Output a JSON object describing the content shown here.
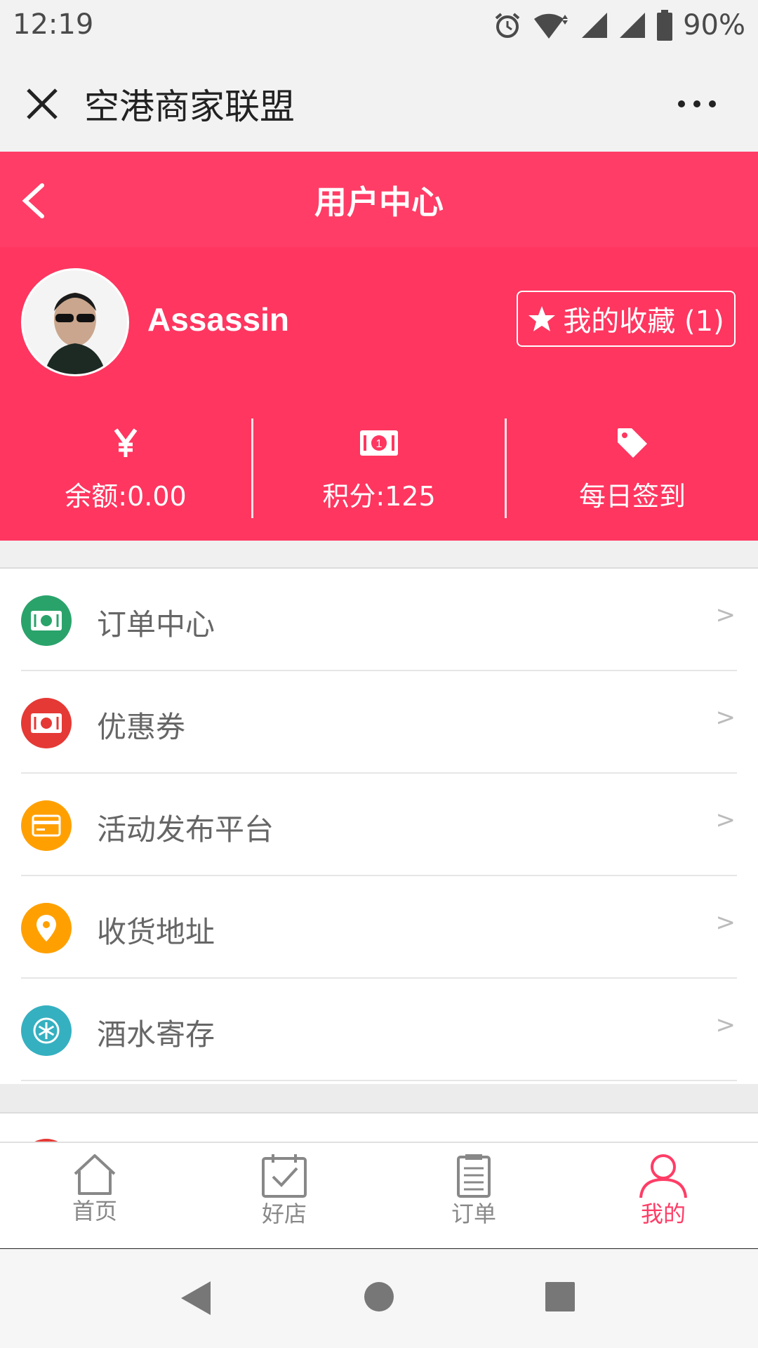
{
  "status_bar": {
    "time": "12:19",
    "battery": "90%",
    "icons": [
      "alarm-icon",
      "wifi-icon",
      "signal-icon",
      "signal-icon",
      "battery-icon"
    ]
  },
  "mini_program": {
    "title": "空港商家联盟"
  },
  "header": {
    "title": "用户中心"
  },
  "profile": {
    "username": "Assassin",
    "favorites_label": "我的收藏 (1)"
  },
  "stats": [
    {
      "icon": "yen-icon",
      "label": "余额:0.00"
    },
    {
      "icon": "cash-icon",
      "label": "积分:125"
    },
    {
      "icon": "tag-icon",
      "label": "每日签到"
    }
  ],
  "menu": [
    {
      "label": "订单中心",
      "icon": "cash-icon",
      "color": "#2aa36b",
      "arrow": ">"
    },
    {
      "label": "优惠券",
      "icon": "cash-icon",
      "color": "#e53935",
      "arrow": ">"
    },
    {
      "label": "活动发布平台",
      "icon": "card-icon",
      "color": "#ffa000",
      "arrow": ">"
    },
    {
      "label": "收货地址",
      "icon": "location-pin-icon",
      "color": "#ffa000",
      "arrow": ">"
    },
    {
      "label": "酒水寄存",
      "icon": "snowflake-icon",
      "color": "#35b0c0",
      "arrow": ">"
    }
  ],
  "tabbar": [
    {
      "label": "首页",
      "icon": "home-icon",
      "active": false
    },
    {
      "label": "好店",
      "icon": "calendar-check-icon",
      "active": false
    },
    {
      "label": "订单",
      "icon": "clipboard-icon",
      "active": false
    },
    {
      "label": "我的",
      "icon": "user-icon",
      "active": true
    }
  ],
  "colors": {
    "accent": "#ff3d66",
    "header": "#ff3660"
  }
}
